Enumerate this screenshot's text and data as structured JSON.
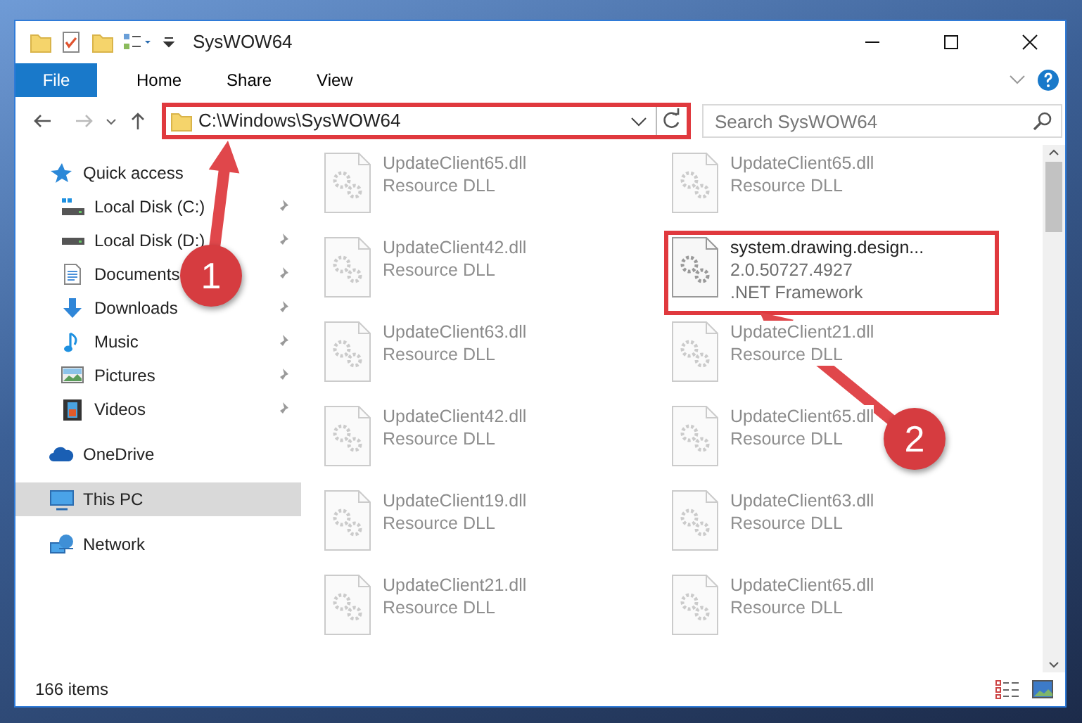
{
  "window": {
    "title": "SysWOW64"
  },
  "ribbon": {
    "file_menu": "File",
    "tabs": [
      {
        "label": "Home",
        "selected": false
      },
      {
        "label": "Share",
        "selected": false
      },
      {
        "label": "View",
        "selected": false
      }
    ]
  },
  "address_bar": {
    "path": "C:\\Windows\\SysWOW64",
    "highlighted": true
  },
  "search": {
    "placeholder": "Search SysWOW64"
  },
  "sidebar": {
    "items": [
      {
        "label": "Quick access",
        "kind": "quick_access",
        "selected": false,
        "children": [
          {
            "label": "Local Disk (C:)",
            "kind": "system_drive",
            "pinned": true,
            "selected": false
          },
          {
            "label": "Local Disk (D:)",
            "kind": "drive",
            "pinned": true,
            "selected": false
          },
          {
            "label": "Documents",
            "kind": "documents",
            "pinned": true,
            "selected": false
          },
          {
            "label": "Downloads",
            "kind": "downloads",
            "pinned": true,
            "selected": false
          },
          {
            "label": "Music",
            "kind": "music",
            "pinned": true,
            "selected": false
          },
          {
            "label": "Pictures",
            "kind": "pictures",
            "pinned": true,
            "selected": false
          },
          {
            "label": "Videos",
            "kind": "videos",
            "pinned": true,
            "selected": false
          }
        ]
      },
      {
        "label": "OneDrive",
        "kind": "cloud",
        "selected": false
      },
      {
        "label": "This PC",
        "kind": "computer",
        "selected": true
      },
      {
        "label": "Network",
        "kind": "network",
        "selected": false
      }
    ]
  },
  "files": [
    {
      "name": "UpdateClient65.dll",
      "details": [
        "Resource DLL"
      ],
      "blurred": true,
      "highlighted": false
    },
    {
      "name": "UpdateClient65.dll",
      "details": [
        "Resource DLL"
      ],
      "blurred": true,
      "highlighted": false
    },
    {
      "name": "UpdateClient42.dll",
      "details": [
        "Resource DLL"
      ],
      "blurred": true,
      "highlighted": false
    },
    {
      "name": "system.drawing.design...",
      "details": [
        "2.0.50727.4927",
        ".NET Framework"
      ],
      "blurred": false,
      "highlighted": true
    },
    {
      "name": "UpdateClient63.dll",
      "details": [
        "Resource DLL"
      ],
      "blurred": true,
      "highlighted": false
    },
    {
      "name": "UpdateClient21.dll",
      "details": [
        "Resource DLL"
      ],
      "blurred": true,
      "highlighted": false
    },
    {
      "name": "UpdateClient42.dll",
      "details": [
        "Resource DLL"
      ],
      "blurred": true,
      "highlighted": false
    },
    {
      "name": "UpdateClient65.dll",
      "details": [
        "Resource DLL"
      ],
      "blurred": true,
      "highlighted": false
    },
    {
      "name": "UpdateClient19.dll",
      "details": [
        "Resource DLL"
      ],
      "blurred": true,
      "highlighted": false
    },
    {
      "name": "UpdateClient63.dll",
      "details": [
        "Resource DLL"
      ],
      "blurred": true,
      "highlighted": false
    },
    {
      "name": "UpdateClient21.dll",
      "details": [
        "Resource DLL"
      ],
      "blurred": true,
      "highlighted": false
    },
    {
      "name": "UpdateClient65.dll",
      "details": [
        "Resource DLL"
      ],
      "blurred": true,
      "highlighted": false
    }
  ],
  "annotations": [
    {
      "label": "1"
    },
    {
      "label": "2"
    }
  ],
  "status_bar": {
    "item_count": "166 items"
  }
}
